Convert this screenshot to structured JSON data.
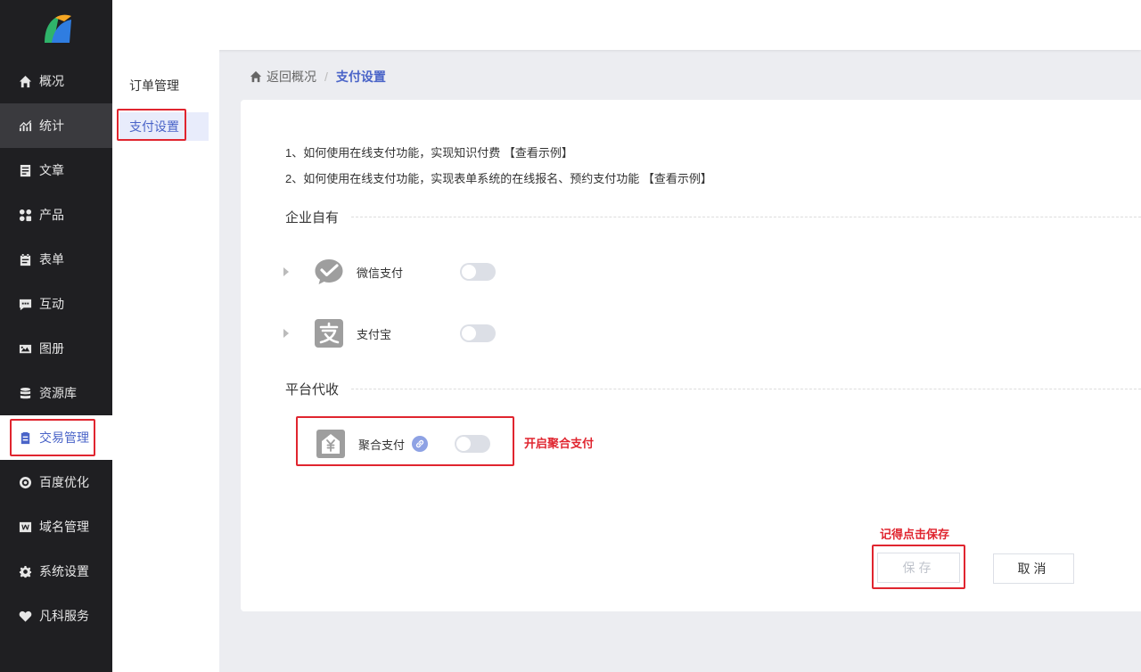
{
  "sidebar": {
    "items": [
      {
        "label": "概况",
        "icon": "home-icon"
      },
      {
        "label": "统计",
        "icon": "chart-icon"
      },
      {
        "label": "文章",
        "icon": "article-icon"
      },
      {
        "label": "产品",
        "icon": "grid-icon"
      },
      {
        "label": "表单",
        "icon": "calendar-icon"
      },
      {
        "label": "互动",
        "icon": "chat-icon"
      },
      {
        "label": "图册",
        "icon": "image-icon"
      },
      {
        "label": "资源库",
        "icon": "database-icon"
      },
      {
        "label": "交易管理",
        "icon": "clipboard-icon"
      },
      {
        "label": "百度优化",
        "icon": "target-icon"
      },
      {
        "label": "域名管理",
        "icon": "w-icon"
      },
      {
        "label": "系统设置",
        "icon": "gear-icon"
      },
      {
        "label": "凡科服务",
        "icon": "heart-icon"
      }
    ]
  },
  "submenu": {
    "items": [
      "订单管理",
      "支付设置"
    ]
  },
  "breadcrumb": {
    "back": "返回概况",
    "separator": "/",
    "current": "支付设置"
  },
  "tips": [
    "1、如何使用在线支付功能，实现知识付费 【查看示例】",
    "2、如何使用在线支付功能，实现表单系统的在线报名、预约支付功能 【查看示例】"
  ],
  "sections": {
    "own": "企业自有",
    "platform": "平台代收"
  },
  "payments": {
    "wechat": "微信支付",
    "alipay": "支付宝",
    "aggregate": "聚合支付"
  },
  "annotations": {
    "enable_aggregate": "开启聚合支付",
    "remember_save": "记得点击保存"
  },
  "buttons": {
    "save": "保存",
    "cancel": "取消"
  },
  "colors": {
    "accent": "#4a64c8",
    "sidebar_bg": "#1f1f22",
    "annotation_red": "#e0252f"
  }
}
